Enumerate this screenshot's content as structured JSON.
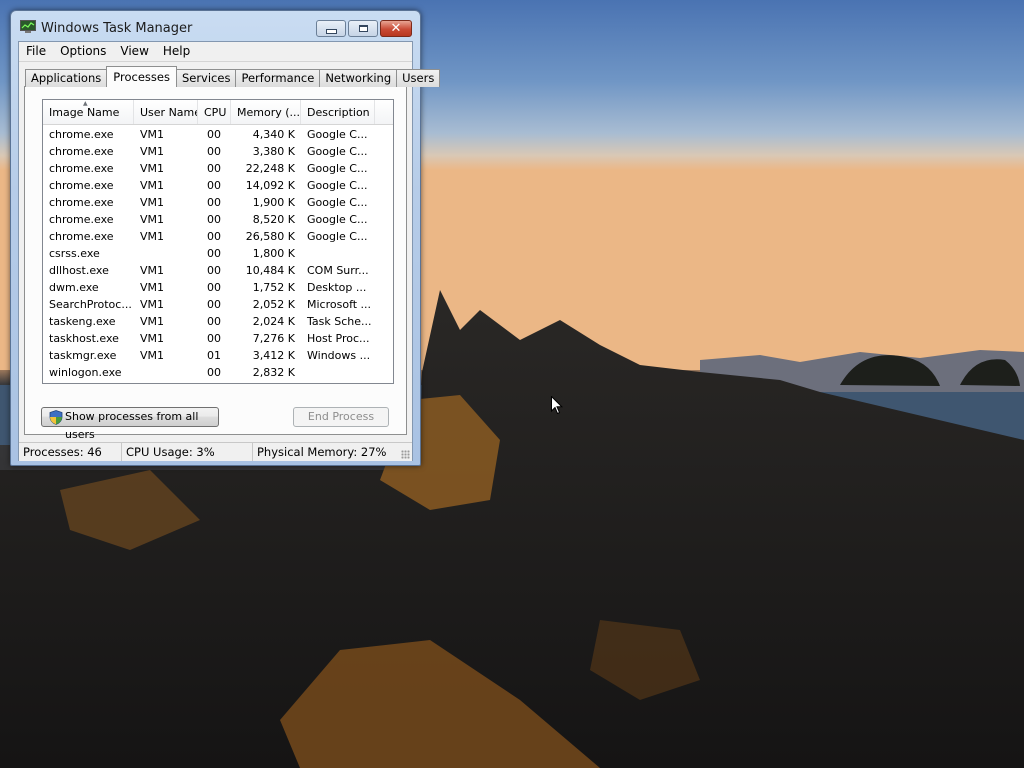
{
  "window": {
    "title": "Windows Task Manager",
    "icon": "task-manager-icon",
    "caption_buttons": [
      "minimize-icon",
      "maximize-icon",
      "close-icon"
    ]
  },
  "menu": {
    "items": [
      "File",
      "Options",
      "View",
      "Help"
    ]
  },
  "tabs": [
    {
      "label": "Applications",
      "active": false
    },
    {
      "label": "Processes",
      "active": true
    },
    {
      "label": "Services",
      "active": false
    },
    {
      "label": "Performance",
      "active": false
    },
    {
      "label": "Networking",
      "active": false
    },
    {
      "label": "Users",
      "active": false
    }
  ],
  "process_table": {
    "columns": [
      "Image Name",
      "User Name",
      "CPU",
      "Memory (...",
      "Description"
    ],
    "sorted_column": "Image Name",
    "rows": [
      {
        "image": "chrome.exe",
        "user": "VM1",
        "cpu": "00",
        "memory": "4,340 K",
        "description": "Google C..."
      },
      {
        "image": "chrome.exe",
        "user": "VM1",
        "cpu": "00",
        "memory": "3,380 K",
        "description": "Google C..."
      },
      {
        "image": "chrome.exe",
        "user": "VM1",
        "cpu": "00",
        "memory": "22,248 K",
        "description": "Google C..."
      },
      {
        "image": "chrome.exe",
        "user": "VM1",
        "cpu": "00",
        "memory": "14,092 K",
        "description": "Google C..."
      },
      {
        "image": "chrome.exe",
        "user": "VM1",
        "cpu": "00",
        "memory": "1,900 K",
        "description": "Google C..."
      },
      {
        "image": "chrome.exe",
        "user": "VM1",
        "cpu": "00",
        "memory": "8,520 K",
        "description": "Google C..."
      },
      {
        "image": "chrome.exe",
        "user": "VM1",
        "cpu": "00",
        "memory": "26,580 K",
        "description": "Google C..."
      },
      {
        "image": "csrss.exe",
        "user": "",
        "cpu": "00",
        "memory": "1,800 K",
        "description": ""
      },
      {
        "image": "dllhost.exe",
        "user": "VM1",
        "cpu": "00",
        "memory": "10,484 K",
        "description": "COM Surr..."
      },
      {
        "image": "dwm.exe",
        "user": "VM1",
        "cpu": "00",
        "memory": "1,752 K",
        "description": "Desktop ..."
      },
      {
        "image": "SearchProtoc...",
        "user": "VM1",
        "cpu": "00",
        "memory": "2,052 K",
        "description": "Microsoft ..."
      },
      {
        "image": "taskeng.exe",
        "user": "VM1",
        "cpu": "00",
        "memory": "2,024 K",
        "description": "Task Sche..."
      },
      {
        "image": "taskhost.exe",
        "user": "VM1",
        "cpu": "00",
        "memory": "7,276 K",
        "description": "Host Proc..."
      },
      {
        "image": "taskmgr.exe",
        "user": "VM1",
        "cpu": "01",
        "memory": "3,412 K",
        "description": "Windows ..."
      },
      {
        "image": "winlogon.exe",
        "user": "",
        "cpu": "00",
        "memory": "2,832 K",
        "description": ""
      }
    ]
  },
  "buttons": {
    "show_all": "Show processes from all users",
    "show_all_icon": "uac-shield-icon",
    "end_process": "End Process",
    "end_process_enabled": false
  },
  "status": {
    "processes": "Processes: 46",
    "cpu": "CPU Usage: 3%",
    "memory": "Physical Memory: 27%"
  },
  "colors": {
    "close_button": "#c94a35",
    "window_frame": "#b6cce8"
  }
}
